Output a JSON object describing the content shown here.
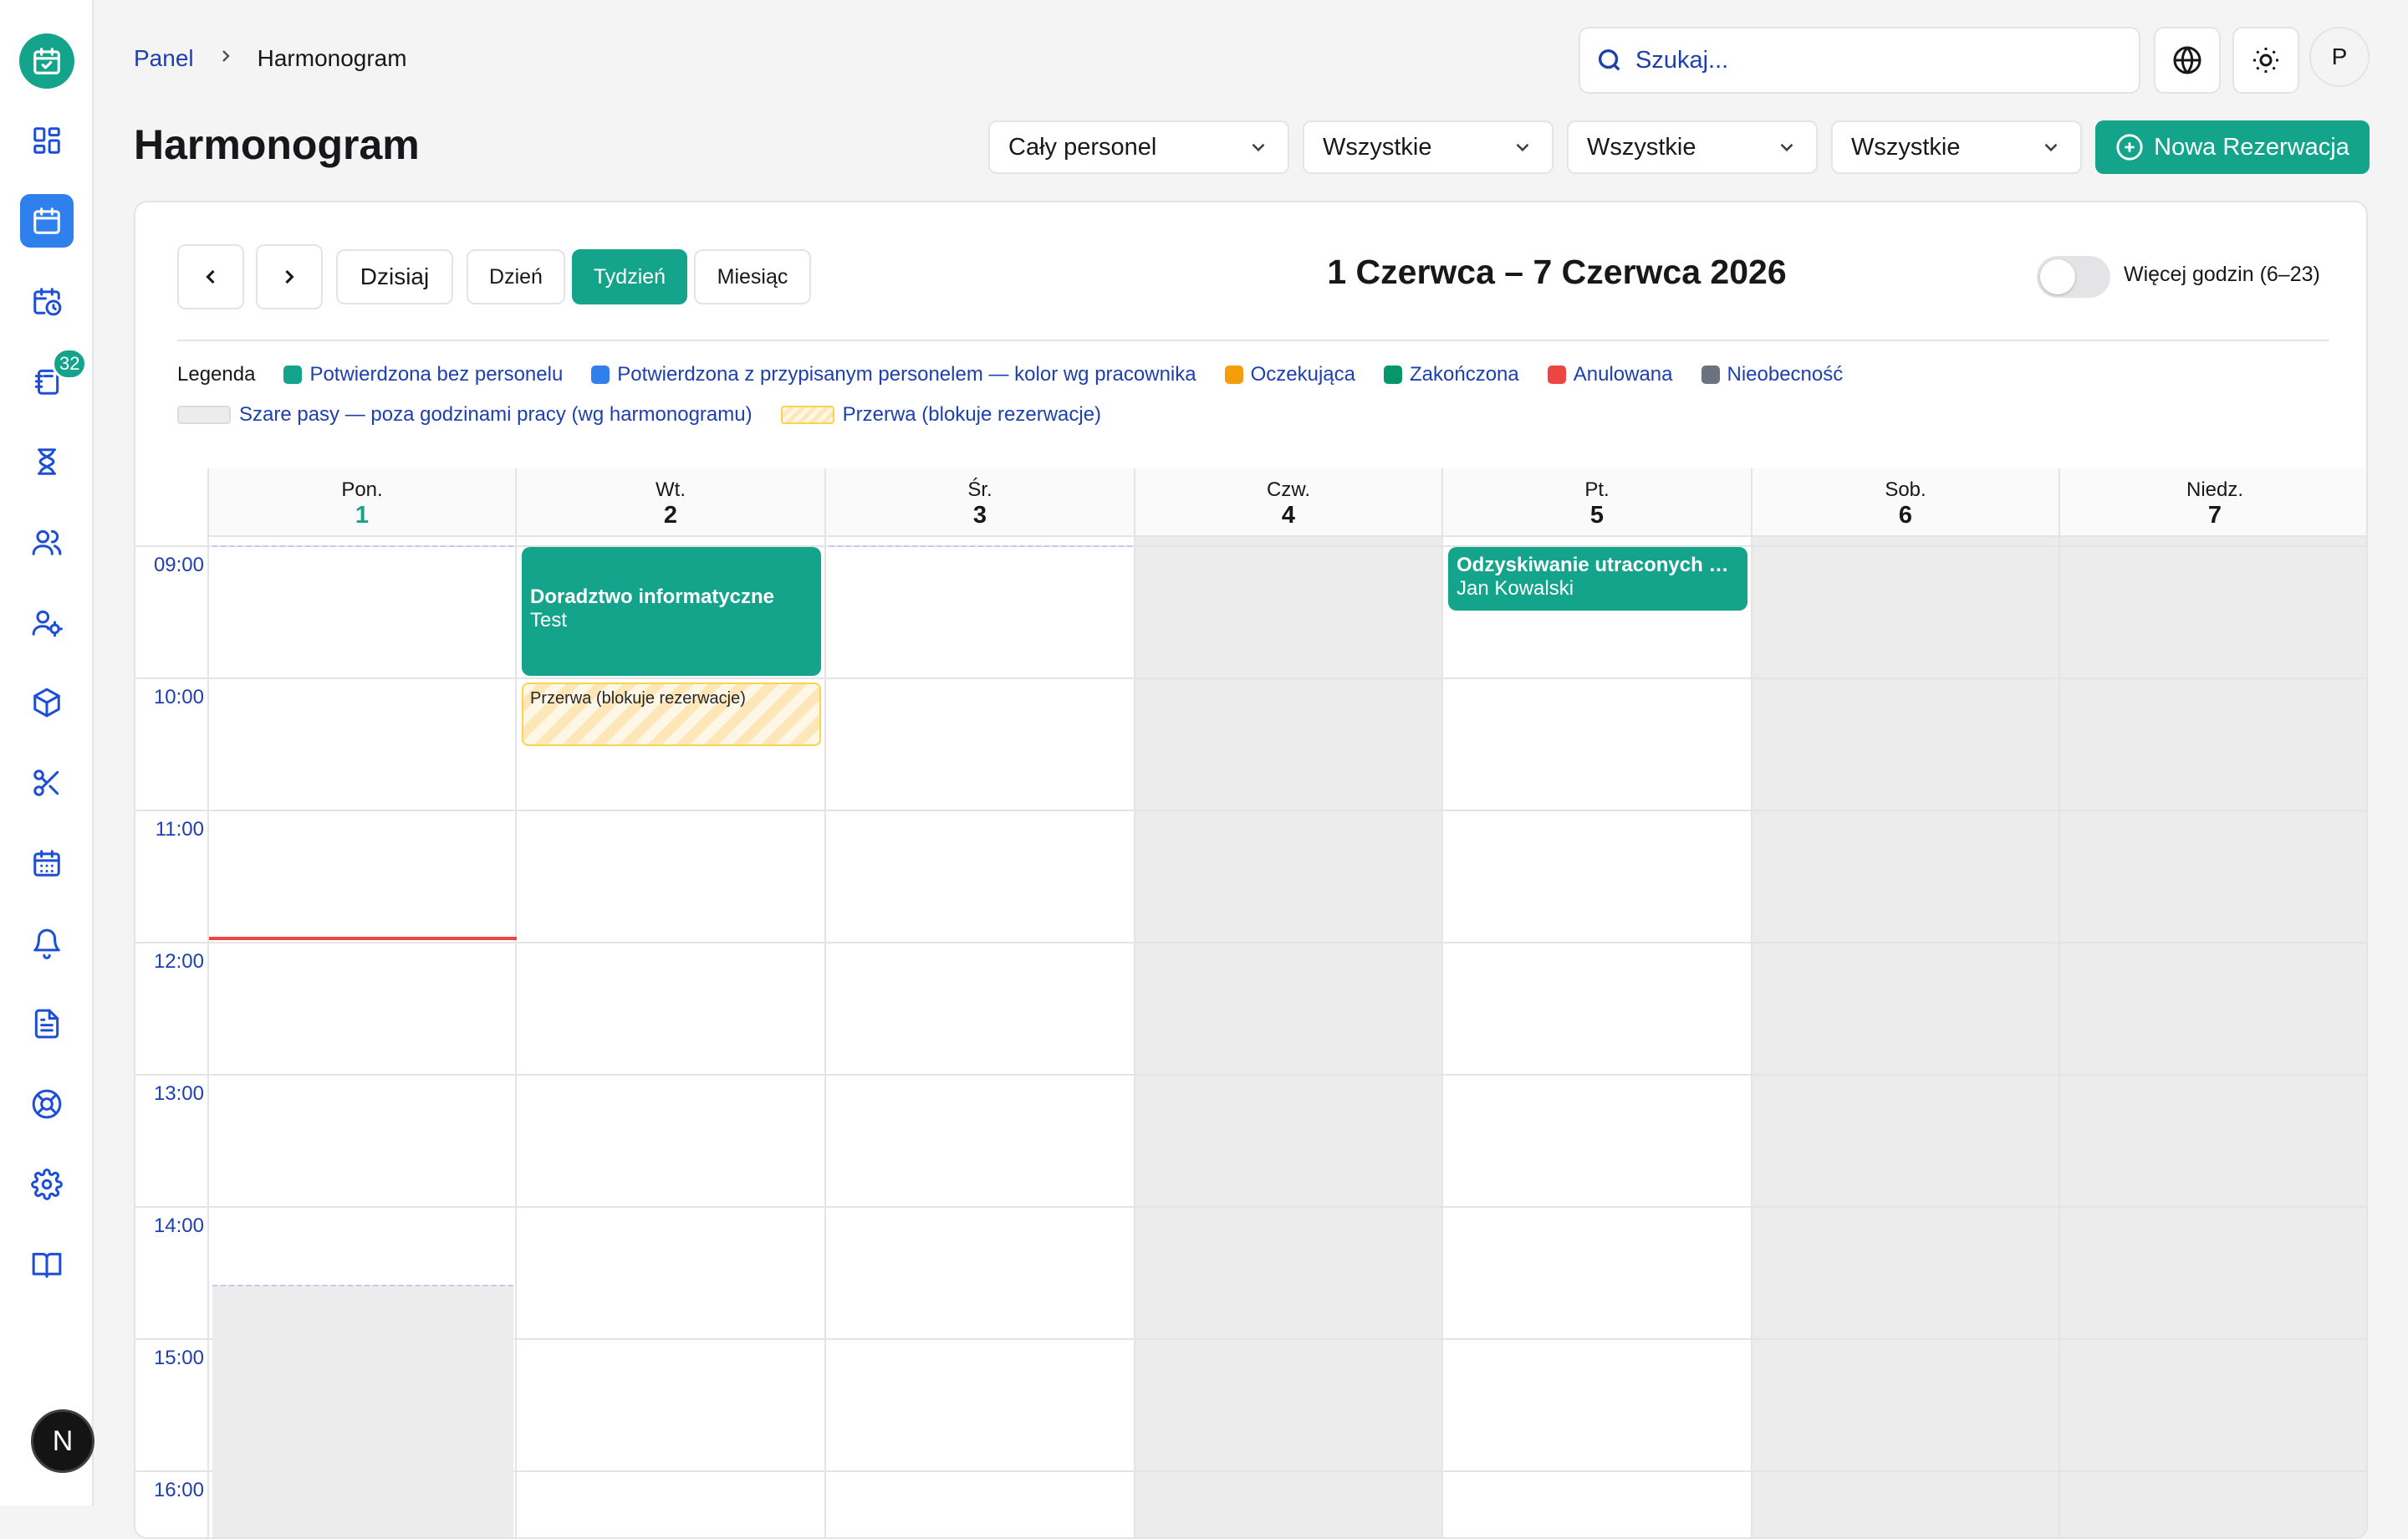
{
  "sidebar": {
    "logo": "calendar-check-icon",
    "items": [
      {
        "icon": "dashboard-icon",
        "name": "dashboard"
      },
      {
        "icon": "calendar-icon",
        "name": "schedule",
        "active": true
      },
      {
        "icon": "calendar-clock-icon",
        "name": "bookings"
      },
      {
        "icon": "notebook-icon",
        "name": "reservations",
        "badge": "32"
      },
      {
        "icon": "hourglass-icon",
        "name": "waitlist"
      },
      {
        "icon": "users-icon",
        "name": "clients"
      },
      {
        "icon": "user-cog-icon",
        "name": "staff"
      },
      {
        "icon": "box-icon",
        "name": "products"
      },
      {
        "icon": "scissors-icon",
        "name": "services"
      },
      {
        "icon": "calendar-grid-icon",
        "name": "work-hours"
      },
      {
        "icon": "bell-icon",
        "name": "notifications"
      },
      {
        "icon": "document-icon",
        "name": "reports"
      },
      {
        "icon": "lifebuoy-icon",
        "name": "support"
      },
      {
        "icon": "gear-icon",
        "name": "settings"
      },
      {
        "icon": "book-icon",
        "name": "docs"
      }
    ],
    "bottom_avatar": "N"
  },
  "header": {
    "breadcrumb": {
      "parent": "Panel",
      "separator": ">",
      "current": "Harmonogram"
    },
    "search_placeholder": "Szukaj...",
    "user_initial": "P"
  },
  "page": {
    "title": "Harmonogram",
    "filters": [
      "Cały personel",
      "Wszystkie",
      "Wszystkie",
      "Wszystkie"
    ],
    "new_button": "Nowa Rezerwacja"
  },
  "calendar": {
    "today_button": "Dzisiaj",
    "views": [
      "Dzień",
      "Tydzień",
      "Miesiąc"
    ],
    "active_view": "Tydzień",
    "range_title": "1 Czerwca – 7 Czerwca 2026",
    "toggle_label": "Więcej godzin (6–23)",
    "toggle_on": false,
    "legend_title": "Legenda",
    "legend": [
      {
        "label": "Potwierdzona bez personelu",
        "color": "#14a38b"
      },
      {
        "label": "Potwierdzona z przypisanym personelem — kolor wg pracownika",
        "color": "#2f80ed"
      },
      {
        "label": "Oczekująca",
        "color": "#f59e0b"
      },
      {
        "label": "Zakończona",
        "color": "#059669"
      },
      {
        "label": "Anulowana",
        "color": "#ef4444"
      },
      {
        "label": "Nieobecność",
        "color": "#6b7280"
      }
    ],
    "legend_row2": [
      {
        "label": "Szare pasy — poza godzinami pracy (wg harmonogramu)",
        "kind": "gray"
      },
      {
        "label": "Przerwa (blokuje rezerwacje)",
        "kind": "striped"
      }
    ],
    "days": [
      {
        "name": "Pon.",
        "num": "1",
        "today": true
      },
      {
        "name": "Wt.",
        "num": "2"
      },
      {
        "name": "Śr.",
        "num": "3"
      },
      {
        "name": "Czw.",
        "num": "4",
        "closed": true
      },
      {
        "name": "Pt.",
        "num": "5"
      },
      {
        "name": "Sob.",
        "num": "6",
        "closed": true
      },
      {
        "name": "Niedz.",
        "num": "7",
        "closed": true
      }
    ],
    "hours": [
      "09:00",
      "10:00",
      "11:00",
      "12:00",
      "13:00",
      "14:00",
      "15:00",
      "16:00"
    ],
    "events": [
      {
        "title": "Doradztwo informatyczne",
        "subtitle": "Test"
      },
      {
        "title": "Odzyskiwanie utraconych danych",
        "subtitle": "Jan Kowalski"
      }
    ],
    "break_label": "Przerwa (blokuje rezerwacje)"
  }
}
